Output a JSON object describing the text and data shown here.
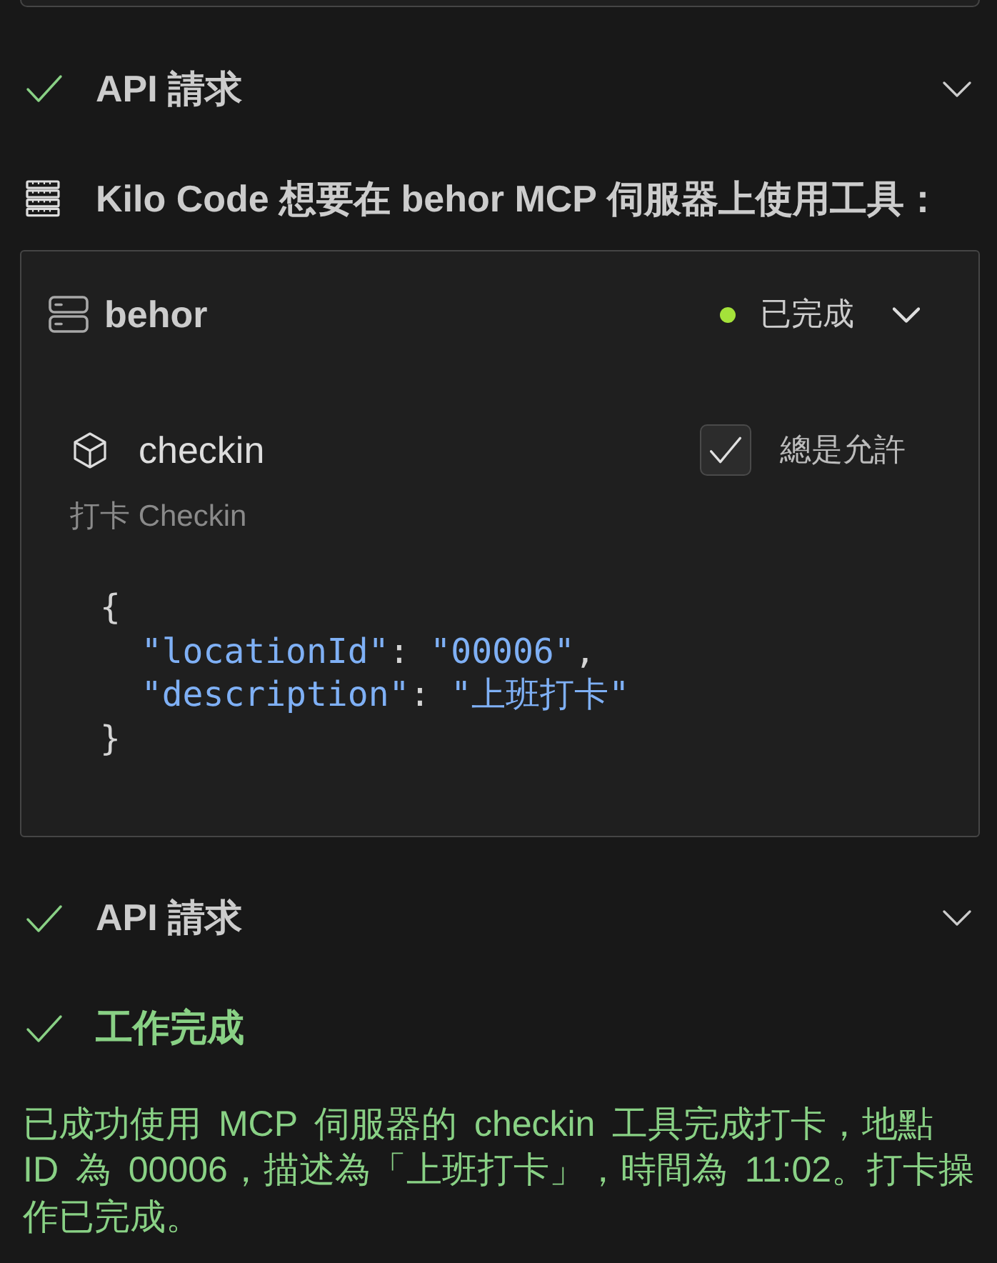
{
  "steps": [
    {
      "kind": "api_request",
      "title": "API 請求"
    },
    {
      "kind": "mcp_use",
      "title": "Kilo Code 想要在 behor MCP 伺服器上使用工具：",
      "server": {
        "name": "behor",
        "status": {
          "label": "已完成",
          "color": "#a4e23a"
        }
      },
      "tool": {
        "name": "checkin",
        "description": "打卡 Checkin",
        "always_allow": {
          "label": "總是允許",
          "checked": true
        },
        "arguments": {
          "open": "{",
          "entries": [
            {
              "tokens": [
                {
                  "kind": "key",
                  "text": "\"locationId\""
                },
                {
                  "kind": "colon",
                  "text": ":"
                },
                {
                  "kind": "string",
                  "text": "\"00006\""
                },
                {
                  "kind": "comma",
                  "text": ","
                }
              ]
            },
            {
              "tokens": [
                {
                  "kind": "key",
                  "text": "\"description\""
                },
                {
                  "kind": "colon",
                  "text": ":"
                },
                {
                  "kind": "string",
                  "text": "\"上班打卡\""
                }
              ]
            }
          ],
          "close": "}"
        }
      }
    },
    {
      "kind": "api_request",
      "title": "API 請求"
    },
    {
      "kind": "completion",
      "title": "工作完成",
      "text": "已成功使用 MCP 伺服器的 checkin 工具完成打卡，地點 ID 為 00006，描述為「上班打卡」，時間為 11:02。打卡操作已完成。"
    }
  ]
}
